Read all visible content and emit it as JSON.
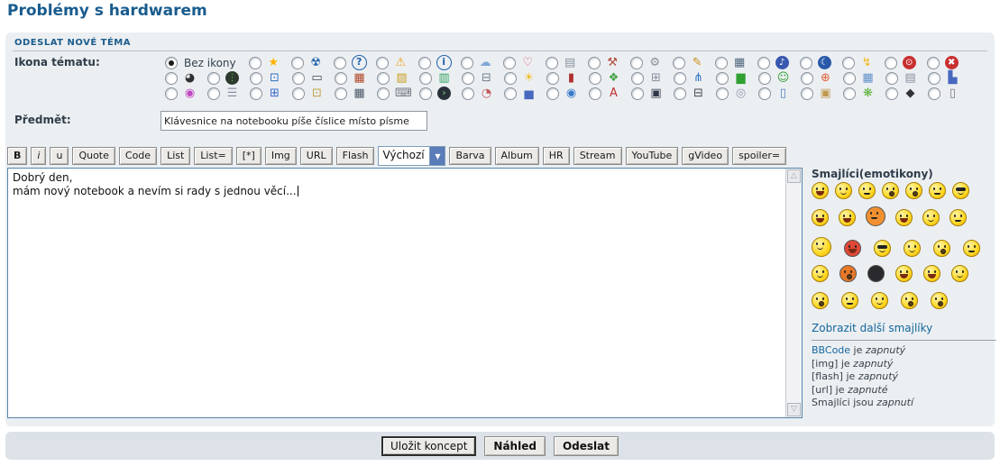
{
  "page": {
    "title": "Problémy s hardwarem"
  },
  "panel": {
    "header": "ODESLAT NOVÉ TÉMA",
    "icon_label": "Ikona tématu:",
    "subject_label": "Předmět:",
    "subject_value": "Klávesnice na notebooku píše číslice místo písme"
  },
  "topic_icons": {
    "none_label": "Bez ikony",
    "rows": [
      [
        {
          "n": "star",
          "g": "★",
          "c": "#FFB300"
        },
        {
          "n": "radiation",
          "g": "☢",
          "c": "#1E5FA8"
        },
        {
          "n": "question",
          "g": "?",
          "c": "#2060A8",
          "ring": "#2060A8"
        },
        {
          "n": "warning",
          "g": "⚠",
          "c": "#F0A018"
        },
        {
          "n": "info",
          "g": "i",
          "c": "#2060A8",
          "ring": "#2060A8"
        },
        {
          "n": "thought-cloud",
          "g": "☁",
          "c": "#7FA8D8"
        },
        {
          "n": "heart",
          "g": "♡",
          "c": "#D85060"
        },
        {
          "n": "copy-pages",
          "g": "▤",
          "c": "#8A95A0"
        },
        {
          "n": "tools",
          "g": "⚒",
          "c": "#B05040"
        },
        {
          "n": "gear",
          "g": "⚙",
          "c": "#8A9098"
        },
        {
          "n": "syringe",
          "g": "✎",
          "c": "#C89020"
        },
        {
          "n": "memory-modules",
          "g": "▦",
          "c": "#506880"
        },
        {
          "n": "music",
          "g": "♪",
          "c": "#fff",
          "bg": "#3858B0",
          "round": true
        },
        {
          "n": "moon",
          "g": "☾",
          "c": "#fff",
          "bg": "#2858A8",
          "round": true
        },
        {
          "n": "lightning",
          "g": "↯",
          "c": "#F0B818"
        },
        {
          "n": "power",
          "g": "⊙",
          "c": "#fff",
          "bg": "#C83030",
          "round": true
        },
        {
          "n": "cross-error",
          "g": "✖",
          "c": "#fff",
          "bg": "#C83030",
          "round": true
        }
      ],
      [
        {
          "n": "gauge",
          "g": "◕",
          "c": "#303030"
        },
        {
          "n": "traffic-light",
          "g": "⋮",
          "c": "#50C040",
          "bg": "#2E3A2E"
        },
        {
          "n": "monitor",
          "g": "⊡",
          "c": "#3070C0"
        },
        {
          "n": "laptop",
          "g": "▭",
          "c": "#404850"
        },
        {
          "n": "firewall",
          "g": "▦",
          "c": "#B04828"
        },
        {
          "n": "barrier",
          "g": "▨",
          "c": "#C8A020"
        },
        {
          "n": "graphics-card",
          "g": "▥",
          "c": "#30A060"
        },
        {
          "n": "printer",
          "g": "⊟",
          "c": "#708090"
        },
        {
          "n": "lightbulb",
          "g": "☀",
          "c": "#F0C020"
        },
        {
          "n": "battery",
          "g": "▮",
          "c": "#B03030"
        },
        {
          "n": "puzzle",
          "g": "❖",
          "c": "#40A040"
        },
        {
          "n": "gamepad",
          "g": "⊞",
          "c": "#8890A0"
        },
        {
          "n": "antenna",
          "g": "⋔",
          "c": "#3070C0"
        },
        {
          "n": "signal-bars",
          "g": "▆",
          "c": "#30A030"
        },
        {
          "n": "green-smiley",
          "g": "☺",
          "c": "#30A030"
        },
        {
          "n": "lifebuoy",
          "g": "⊕",
          "c": "#E06038"
        },
        {
          "n": "calendar",
          "g": "▦",
          "c": "#6090C8"
        },
        {
          "n": "notes",
          "g": "▤",
          "c": "#8890A0"
        },
        {
          "n": "color-cubes",
          "g": "▙",
          "c": "#4868C0"
        }
      ],
      [
        {
          "n": "color-wheel",
          "g": "◉",
          "c": "#C048C0"
        },
        {
          "n": "database",
          "g": "☰",
          "c": "#8890A0"
        },
        {
          "n": "windows",
          "g": "⊞",
          "c": "#3868C8"
        },
        {
          "n": "lock",
          "g": "⊡",
          "c": "#C0A040"
        },
        {
          "n": "calculator",
          "g": "▦",
          "c": "#485868"
        },
        {
          "n": "keyboard",
          "g": "⌨",
          "c": "#707880"
        },
        {
          "n": "terminal",
          "g": "›",
          "c": "#80E080",
          "bg": "#283038"
        },
        {
          "n": "pie-document",
          "g": "◔",
          "c": "#C05858"
        },
        {
          "n": "bar-chart",
          "g": "▅",
          "c": "#4868C0"
        },
        {
          "n": "globe",
          "g": "◉",
          "c": "#3878C8"
        },
        {
          "n": "pdf",
          "g": "A",
          "c": "#C03030"
        },
        {
          "n": "floppy",
          "g": "▣",
          "c": "#303848"
        },
        {
          "n": "hard-drive",
          "g": "⊟",
          "c": "#404850"
        },
        {
          "n": "cd",
          "g": "◎",
          "c": "#9098B0"
        },
        {
          "n": "usb-stick",
          "g": "▯",
          "c": "#5080C0"
        },
        {
          "n": "package-box",
          "g": "▣",
          "c": "#C09850"
        },
        {
          "n": "icq-flower",
          "g": "❋",
          "c": "#58B038"
        },
        {
          "n": "cooking-pot",
          "g": "◆",
          "c": "#303038"
        },
        {
          "n": "trash",
          "g": "▯",
          "c": "#787880"
        }
      ]
    ]
  },
  "toolbar": {
    "left_buttons": [
      {
        "n": "bold",
        "label": "B",
        "style": "b"
      },
      {
        "n": "italic",
        "label": "i",
        "style": "i"
      },
      {
        "n": "underline",
        "label": "u"
      },
      {
        "n": "quote",
        "label": "Quote"
      },
      {
        "n": "code",
        "label": "Code"
      },
      {
        "n": "list",
        "label": "List"
      },
      {
        "n": "list-ordered",
        "label": "List="
      },
      {
        "n": "list-item",
        "label": "[*]"
      },
      {
        "n": "img",
        "label": "Img"
      },
      {
        "n": "url",
        "label": "URL"
      },
      {
        "n": "flash",
        "label": "Flash"
      }
    ],
    "select_value": "Výchozí",
    "select_arrow_glyph": "▼",
    "right_buttons": [
      {
        "n": "color",
        "label": "Barva"
      },
      {
        "n": "album",
        "label": "Album"
      },
      {
        "n": "hr",
        "label": "HR"
      },
      {
        "n": "stream",
        "label": "Stream"
      },
      {
        "n": "youtube",
        "label": "YouTube"
      },
      {
        "n": "gvideo",
        "label": "gVideo"
      },
      {
        "n": "spoiler",
        "label": "spoiler="
      }
    ]
  },
  "editor": {
    "line1": "Dobrý den,",
    "line2": "mám nový notebook a nevím si rady s jednou věcí...",
    "scroll_up_glyph": "△",
    "scroll_down_glyph": "▽"
  },
  "smileys": {
    "title": "Smajlíci(emotikony)",
    "rows": [
      [
        {
          "n": "grin",
          "v": "d"
        },
        {
          "n": "smile",
          "v": "smile"
        },
        {
          "n": "frown",
          "v": "flat"
        },
        {
          "n": "shock",
          "v": "o"
        },
        {
          "n": "eek",
          "v": "o"
        },
        {
          "n": "smirk",
          "v": "flat"
        },
        {
          "n": "cool",
          "v": "cool"
        }
      ],
      [
        {
          "n": "laugh",
          "v": "d"
        },
        {
          "n": "evil-grin",
          "v": "d"
        },
        {
          "n": "angry",
          "v": "flat",
          "c": "#F09030",
          "s": 22
        },
        {
          "n": "razz",
          "v": "d"
        },
        {
          "n": "embarrassed",
          "v": "smile"
        },
        {
          "n": "cry",
          "v": "flat"
        }
      ],
      [
        {
          "n": "bat-smiley",
          "v": "smile",
          "s": 22
        },
        {
          "n": "devil",
          "v": "d",
          "c": "#E04838"
        },
        {
          "n": "cool-dark",
          "v": "cool"
        },
        {
          "n": "wink",
          "v": "smile"
        },
        {
          "n": "rolleyes",
          "v": "o"
        },
        {
          "n": "neutral",
          "v": "flat"
        }
      ],
      [
        {
          "n": "arms-out",
          "v": "smile"
        },
        {
          "n": "mad-orange",
          "v": "o",
          "c": "#E87828"
        },
        {
          "n": "bomb",
          "v": "bomb",
          "c": "#2A2A2E"
        },
        {
          "n": "pirate",
          "v": "d"
        },
        {
          "n": "grr",
          "v": "d"
        },
        {
          "n": "plain",
          "v": "smile"
        }
      ],
      [
        {
          "n": "raised-brow",
          "v": "o"
        },
        {
          "n": "thinking",
          "v": "flat"
        },
        {
          "n": "in-love",
          "v": "smile"
        },
        {
          "n": "wide-eyed",
          "v": "o"
        },
        {
          "n": "surprised",
          "v": "o"
        }
      ]
    ],
    "more_link": "Zobrazit další smajlíky"
  },
  "status_lines": [
    {
      "n": "bbcode-status",
      "subject": "BBCode",
      "link": true,
      "verb": "je",
      "state": "zapnutý"
    },
    {
      "n": "img-status",
      "subject": "[img]",
      "link": false,
      "verb": "je",
      "state": "zapnutý"
    },
    {
      "n": "flash-status",
      "subject": "[flash]",
      "link": false,
      "verb": "je",
      "state": "zapnutý"
    },
    {
      "n": "url-status",
      "subject": "[url]",
      "link": false,
      "verb": "je",
      "state": "zapnuté"
    },
    {
      "n": "smileys-status",
      "subject": "Smajlíci",
      "link": false,
      "verb": "jsou",
      "state": "zapnutí"
    }
  ],
  "footer": {
    "buttons": [
      {
        "n": "save-draft-button",
        "label": "Uložit koncept",
        "strong": false,
        "focused": true
      },
      {
        "n": "preview-button",
        "label": "Náhled",
        "strong": true,
        "focused": false
      },
      {
        "n": "submit-button",
        "label": "Odeslat",
        "strong": true,
        "focused": false
      }
    ]
  }
}
